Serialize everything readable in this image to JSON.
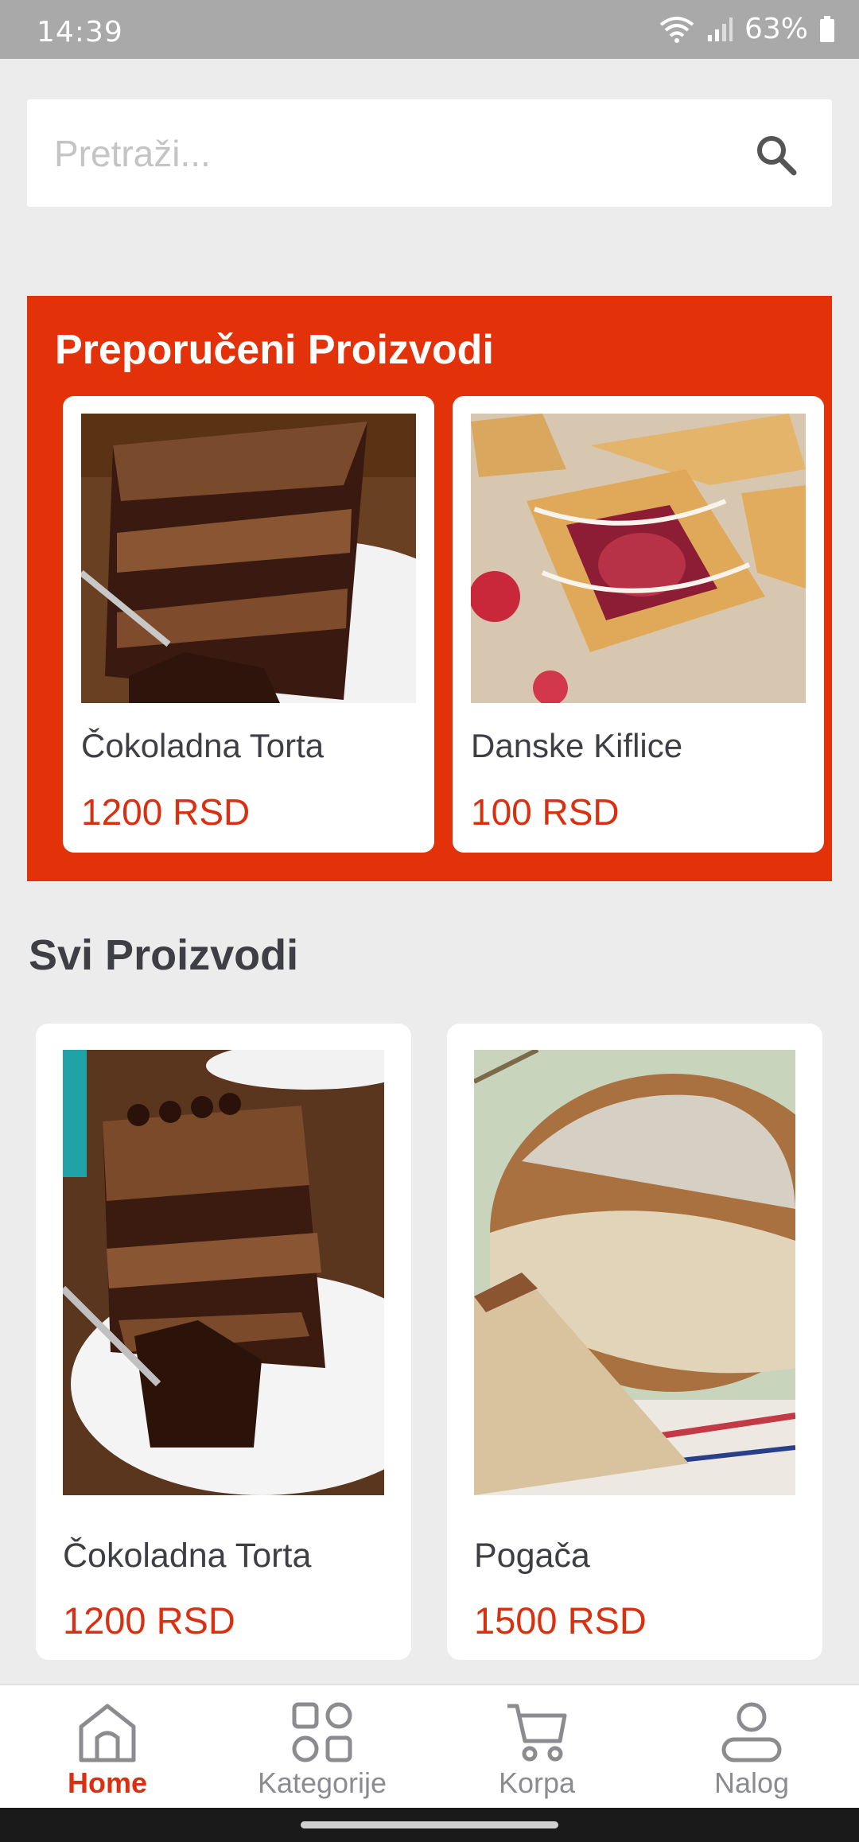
{
  "status_bar": {
    "time": "14:39",
    "battery": "63%"
  },
  "search": {
    "placeholder": "Pretraži..."
  },
  "featured": {
    "title": "Preporučeni Proizvodi",
    "items": [
      {
        "name": "Čokoladna Torta",
        "price": "1200 RSD",
        "image": "chocolate-cake"
      },
      {
        "name": "Danske Kiflice",
        "price": "100 RSD",
        "image": "danish-pastry"
      }
    ]
  },
  "all_products": {
    "title": "Svi Proizvodi",
    "items": [
      {
        "name": "Čokoladna Torta",
        "price": "1200 RSD",
        "image": "chocolate-cake"
      },
      {
        "name": "Pogača",
        "price": "1500 RSD",
        "image": "bread-loaf"
      }
    ]
  },
  "nav": {
    "items": [
      {
        "label": "Home",
        "icon": "home-icon",
        "active": true
      },
      {
        "label": "Kategorije",
        "icon": "categories-icon",
        "active": false
      },
      {
        "label": "Korpa",
        "icon": "cart-icon",
        "active": false
      },
      {
        "label": "Nalog",
        "icon": "account-icon",
        "active": false
      }
    ]
  },
  "colors": {
    "accent": "#e3310a",
    "price": "#d83010",
    "background": "#ececec",
    "text": "#3d3f44"
  }
}
